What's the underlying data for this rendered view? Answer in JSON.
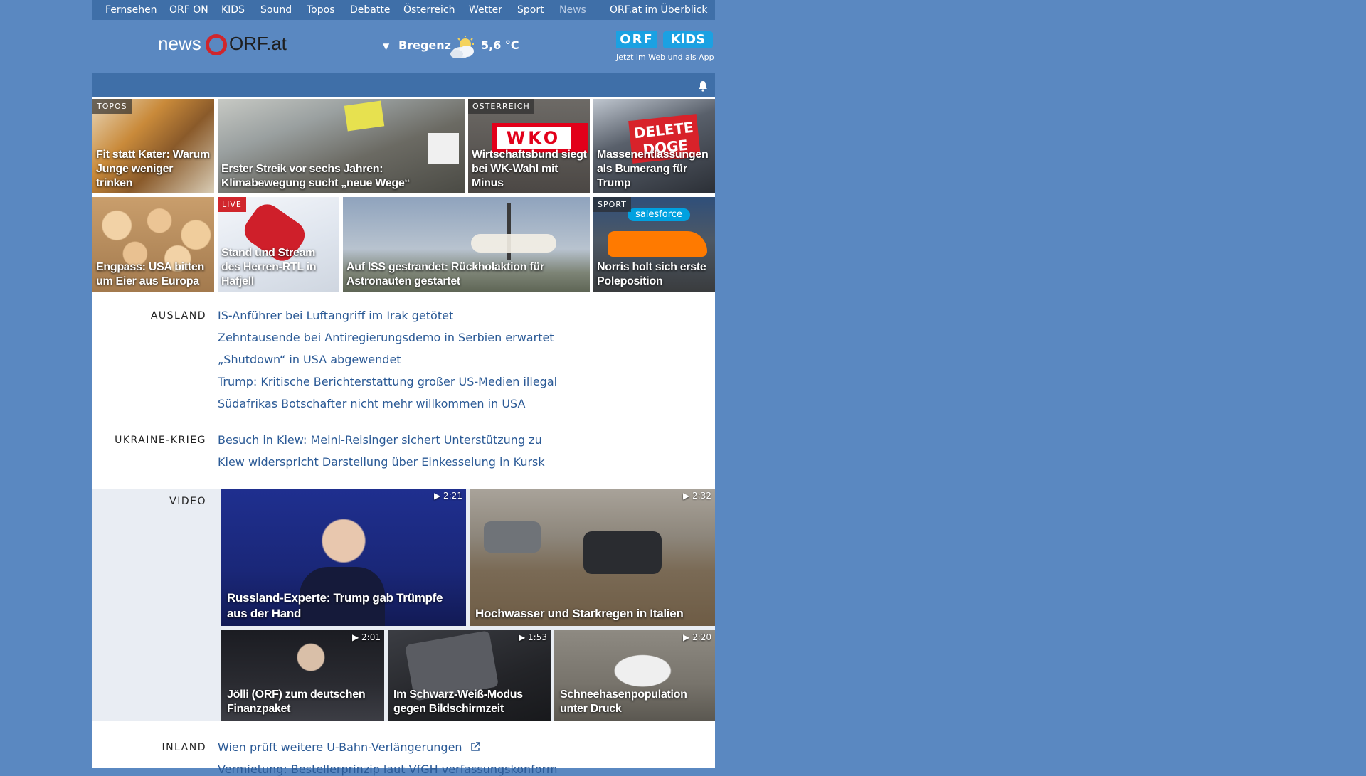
{
  "nav": {
    "items": [
      "Fernsehen",
      "ORF ON",
      "KIDS",
      "Sound",
      "Topos",
      "Debatte",
      "Österreich",
      "Wetter",
      "Sport",
      "News",
      "ORF.at im Überblick"
    ]
  },
  "header": {
    "logo_news": "news",
    "logo_orf": "ORF.at",
    "weather_city": "Bregenz",
    "weather_temp": "5,6 °C",
    "kids_orf": "ORF",
    "kids_label": "KiDS",
    "kids_caption": "Jetzt im Web und als App"
  },
  "tiles_row1": [
    {
      "tag": "TOPOS",
      "title": "Fit statt Kater: Warum Junge weniger trinken"
    },
    {
      "tag": "",
      "title": "Erster Streik vor sechs Jahren: Klimabewegung sucht „neue Wege“"
    },
    {
      "tag": "ÖSTERREICH",
      "title": "Wirtschaftsbund siegt bei WK-Wahl mit Minus"
    },
    {
      "tag": "",
      "title": "Massenentlassungen als Bumerang für Trump"
    }
  ],
  "tiles_row2": [
    {
      "tag": "",
      "title": "Engpass: USA bitten um Eier aus Europa"
    },
    {
      "tag": "LIVE",
      "title": "Stand und Stream des Herren-RTL in Hafjell"
    },
    {
      "tag": "",
      "title": "Auf ISS gestrandet: Rückholaktion für Astronauten gestartet"
    },
    {
      "tag": "SPORT",
      "title": "Norris holt sich erste Poleposition"
    }
  ],
  "sections": {
    "ausland": {
      "label": "AUSLAND",
      "links": [
        "IS-Anführer bei Luftangriff im Irak getötet",
        "Zehntausende bei Antiregierungsdemo in Serbien erwartet",
        "„Shutdown“ in USA abgewendet",
        "Trump: Kritische Berichterstattung großer US-Medien illegal",
        "Südafrikas Botschafter nicht mehr willkommen in USA"
      ]
    },
    "ukraine": {
      "label": "UKRAINE-KRIEG",
      "links": [
        "Besuch in Kiew: Meinl-Reisinger sichert Unterstützung zu",
        "Kiew widerspricht Darstellung über Einkesselung in Kursk"
      ]
    },
    "video": {
      "label": "VIDEO",
      "items": [
        {
          "duration": "2:21",
          "title": "Russland-Experte: Trump gab Trümpfe aus der Hand"
        },
        {
          "duration": "2:32",
          "title": "Hochwasser und Starkregen in Italien"
        },
        {
          "duration": "2:01",
          "title": "Jölli (ORF) zum deutschen Finanzpaket"
        },
        {
          "duration": "1:53",
          "title": "Im Schwarz-Weiß-Modus gegen Bildschirmzeit"
        },
        {
          "duration": "2:20",
          "title": "Schneehasenpopulation unter Druck"
        }
      ]
    },
    "inland": {
      "label": "INLAND",
      "links": [
        "Wien prüft weitere U-Bahn-Verlängerungen",
        "Vermietung: Bestellerprinzip laut VfGH verfassungskonform"
      ]
    }
  }
}
